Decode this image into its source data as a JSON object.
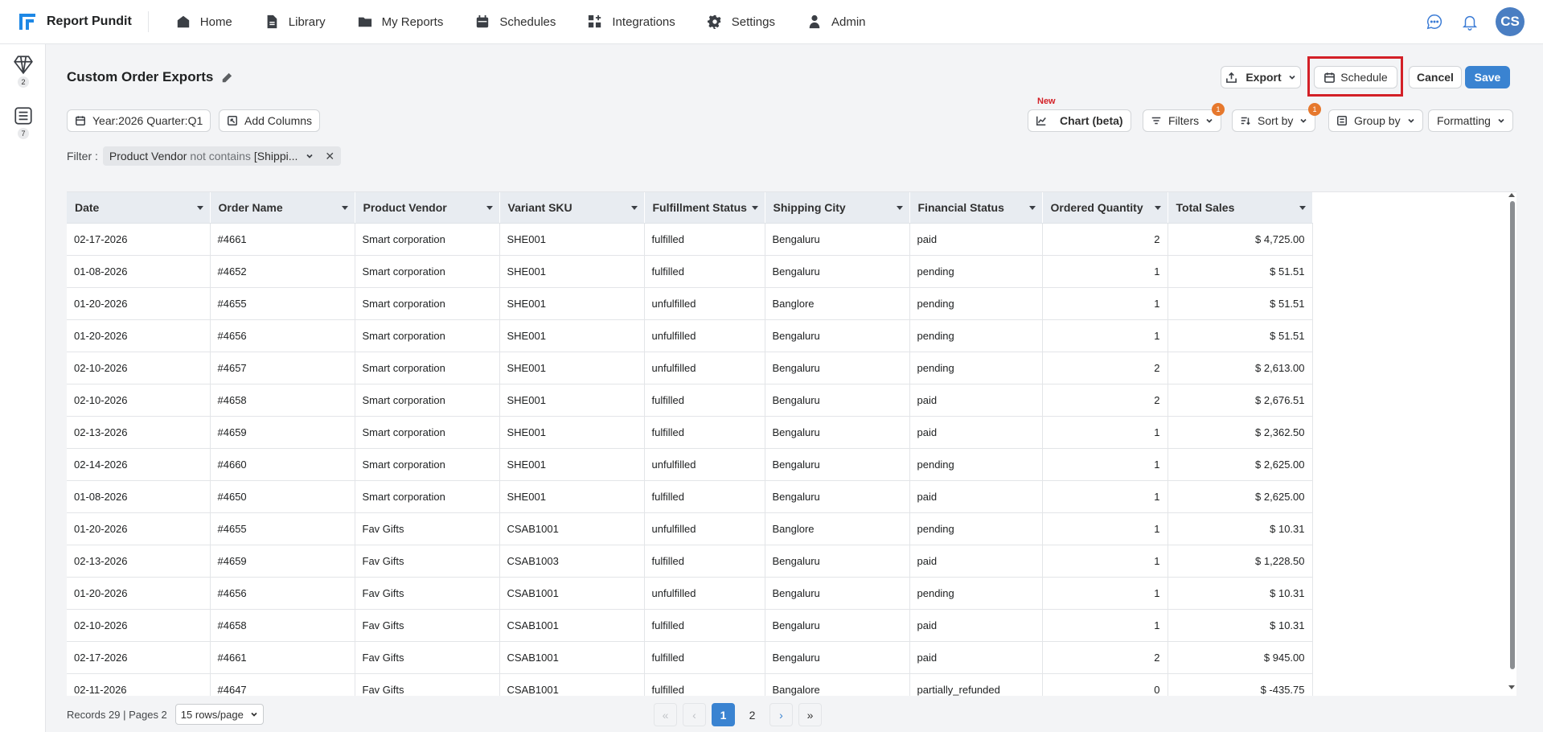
{
  "app": {
    "name": "Report Pundit",
    "avatar_initials": "CS"
  },
  "nav": {
    "items": [
      {
        "label": "Home",
        "icon": "home-icon"
      },
      {
        "label": "Library",
        "icon": "library-icon"
      },
      {
        "label": "My Reports",
        "icon": "folder-icon"
      },
      {
        "label": "Schedules",
        "icon": "calendar-icon"
      },
      {
        "label": "Integrations",
        "icon": "integrations-icon"
      },
      {
        "label": "Settings",
        "icon": "gear-icon"
      },
      {
        "label": "Admin",
        "icon": "user-icon"
      }
    ]
  },
  "rail": {
    "items": [
      {
        "icon": "diamond-icon",
        "badge": "2"
      },
      {
        "icon": "list-icon",
        "badge": "7"
      }
    ]
  },
  "report": {
    "title": "Custom Order Exports",
    "export_label": "Export",
    "schedule_label": "Schedule",
    "cancel_label": "Cancel",
    "save_label": "Save",
    "period_label": "Year:2026 Quarter:Q1",
    "add_columns_label": "Add Columns",
    "new_label": "New",
    "chart_label": "Chart (beta)",
    "filters_label": "Filters",
    "filters_count": "1",
    "sort_label": "Sort by",
    "sort_count": "1",
    "group_label": "Group by",
    "formatting_label": "Formatting"
  },
  "filter": {
    "prefix": "Filter :",
    "field": "Product Vendor",
    "operator": "not contains",
    "value": "[Shippi...",
    "remove": "✕"
  },
  "table": {
    "columns": [
      "Date",
      "Order Name",
      "Product Vendor",
      "Variant SKU",
      "Fulfillment Status",
      "Shipping City",
      "Financial Status",
      "Ordered Quantity",
      "Total Sales"
    ],
    "rows": [
      [
        "02-17-2026",
        "#4661",
        "Smart corporation",
        "SHE001",
        "fulfilled",
        "Bengaluru",
        "paid",
        "2",
        "$ 4,725.00"
      ],
      [
        "01-08-2026",
        "#4652",
        "Smart corporation",
        "SHE001",
        "fulfilled",
        "Bengaluru",
        "pending",
        "1",
        "$ 51.51"
      ],
      [
        "01-20-2026",
        "#4655",
        "Smart corporation",
        "SHE001",
        "unfulfilled",
        "Banglore",
        "pending",
        "1",
        "$ 51.51"
      ],
      [
        "01-20-2026",
        "#4656",
        "Smart corporation",
        "SHE001",
        "unfulfilled",
        "Bengaluru",
        "pending",
        "1",
        "$ 51.51"
      ],
      [
        "02-10-2026",
        "#4657",
        "Smart corporation",
        "SHE001",
        "unfulfilled",
        "Bengaluru",
        "pending",
        "2",
        "$ 2,613.00"
      ],
      [
        "02-10-2026",
        "#4658",
        "Smart corporation",
        "SHE001",
        "fulfilled",
        "Bengaluru",
        "paid",
        "2",
        "$ 2,676.51"
      ],
      [
        "02-13-2026",
        "#4659",
        "Smart corporation",
        "SHE001",
        "fulfilled",
        "Bengaluru",
        "paid",
        "1",
        "$ 2,362.50"
      ],
      [
        "02-14-2026",
        "#4660",
        "Smart corporation",
        "SHE001",
        "unfulfilled",
        "Bengaluru",
        "pending",
        "1",
        "$ 2,625.00"
      ],
      [
        "01-08-2026",
        "#4650",
        "Smart corporation",
        "SHE001",
        "fulfilled",
        "Bengaluru",
        "paid",
        "1",
        "$ 2,625.00"
      ],
      [
        "01-20-2026",
        "#4655",
        "Fav Gifts",
        "CSAB1001",
        "unfulfilled",
        "Banglore",
        "pending",
        "1",
        "$ 10.31"
      ],
      [
        "02-13-2026",
        "#4659",
        "Fav Gifts",
        "CSAB1003",
        "fulfilled",
        "Bengaluru",
        "paid",
        "1",
        "$ 1,228.50"
      ],
      [
        "01-20-2026",
        "#4656",
        "Fav Gifts",
        "CSAB1001",
        "unfulfilled",
        "Bengaluru",
        "pending",
        "1",
        "$ 10.31"
      ],
      [
        "02-10-2026",
        "#4658",
        "Fav Gifts",
        "CSAB1001",
        "fulfilled",
        "Bengaluru",
        "paid",
        "1",
        "$ 10.31"
      ],
      [
        "02-17-2026",
        "#4661",
        "Fav Gifts",
        "CSAB1001",
        "fulfilled",
        "Bengaluru",
        "paid",
        "2",
        "$ 945.00"
      ],
      [
        "02-11-2026",
        "#4647",
        "Fav Gifts",
        "CSAB1001",
        "fulfilled",
        "Bangalore",
        "partially_refunded",
        "0",
        "$ -435.75"
      ]
    ]
  },
  "footer": {
    "records_text": "Records 29 | Pages 2",
    "rows_per_page": "15 rows/page",
    "pages": [
      "1",
      "2"
    ],
    "current_page": "1"
  },
  "colors": {
    "accent": "#3a83d1",
    "highlight": "#d32027",
    "badge": "#e6782d"
  }
}
